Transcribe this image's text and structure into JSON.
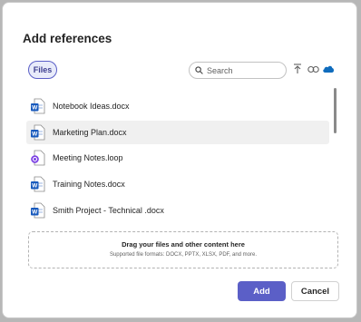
{
  "dialog": {
    "title": "Add references",
    "files_tab_label": "Files",
    "search_placeholder": "Search",
    "files": [
      {
        "name": "Notebook Ideas.docx",
        "type": "word"
      },
      {
        "name": "Marketing Plan.docx",
        "type": "word",
        "selected": true
      },
      {
        "name": "Meeting Notes.loop",
        "type": "loop"
      },
      {
        "name": " Training Notes.docx",
        "type": "word"
      },
      {
        "name": "Smith Project - Technical .docx",
        "type": "word"
      }
    ],
    "dropzone": {
      "title": "Drag your files and other content here",
      "subtitle": "Supported file formats: DOCX, PPTX, XLSX, PDF, and more."
    },
    "add_label": "Add",
    "cancel_label": "Cancel"
  },
  "colors": {
    "accent": "#5b5fc7",
    "word_blue": "#185abd",
    "onedrive_blue": "#0f6cbd",
    "loop_purple": "#7b3fe4"
  }
}
